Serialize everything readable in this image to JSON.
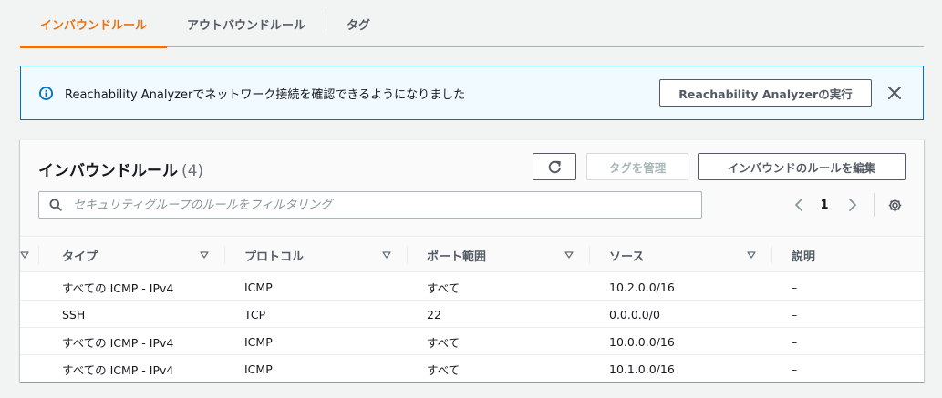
{
  "tabs": [
    {
      "label": "インバウンドルール",
      "active": true
    },
    {
      "label": "アウトバウンドルール",
      "active": false
    },
    {
      "label": "タグ",
      "active": false
    }
  ],
  "flash": {
    "message": "Reachability Analyzerでネットワーク接続を確認できるようになりました",
    "button_label": "Reachability Analyzerの実行"
  },
  "panel": {
    "title": "インバウンドルール",
    "count": "(4)",
    "manage_tags_label": "タグを管理",
    "edit_rules_label": "インバウンドのルールを編集",
    "search_placeholder": "セキュリティグループのルールをフィルタリング",
    "current_page": "1"
  },
  "table": {
    "columns": [
      "タイプ",
      "プロトコル",
      "ポート範囲",
      "ソース",
      "説明"
    ],
    "rows": [
      [
        "すべての ICMP - IPv4",
        "ICMP",
        "すべて",
        "10.2.0.0/16",
        "–"
      ],
      [
        "SSH",
        "TCP",
        "22",
        "0.0.0.0/0",
        "–"
      ],
      [
        "すべての ICMP - IPv4",
        "ICMP",
        "すべて",
        "10.0.0.0/16",
        "–"
      ],
      [
        "すべての ICMP - IPv4",
        "ICMP",
        "すべて",
        "10.1.0.0/16",
        "–"
      ]
    ]
  },
  "colors": {
    "accent": "#ec7211",
    "info_border": "#0073bb",
    "info_background": "#f1faff"
  },
  "icons": [
    "info-icon",
    "close-icon",
    "refresh-icon",
    "search-icon",
    "chevron-left-icon",
    "chevron-right-icon",
    "settings-icon",
    "sort-icon"
  ]
}
